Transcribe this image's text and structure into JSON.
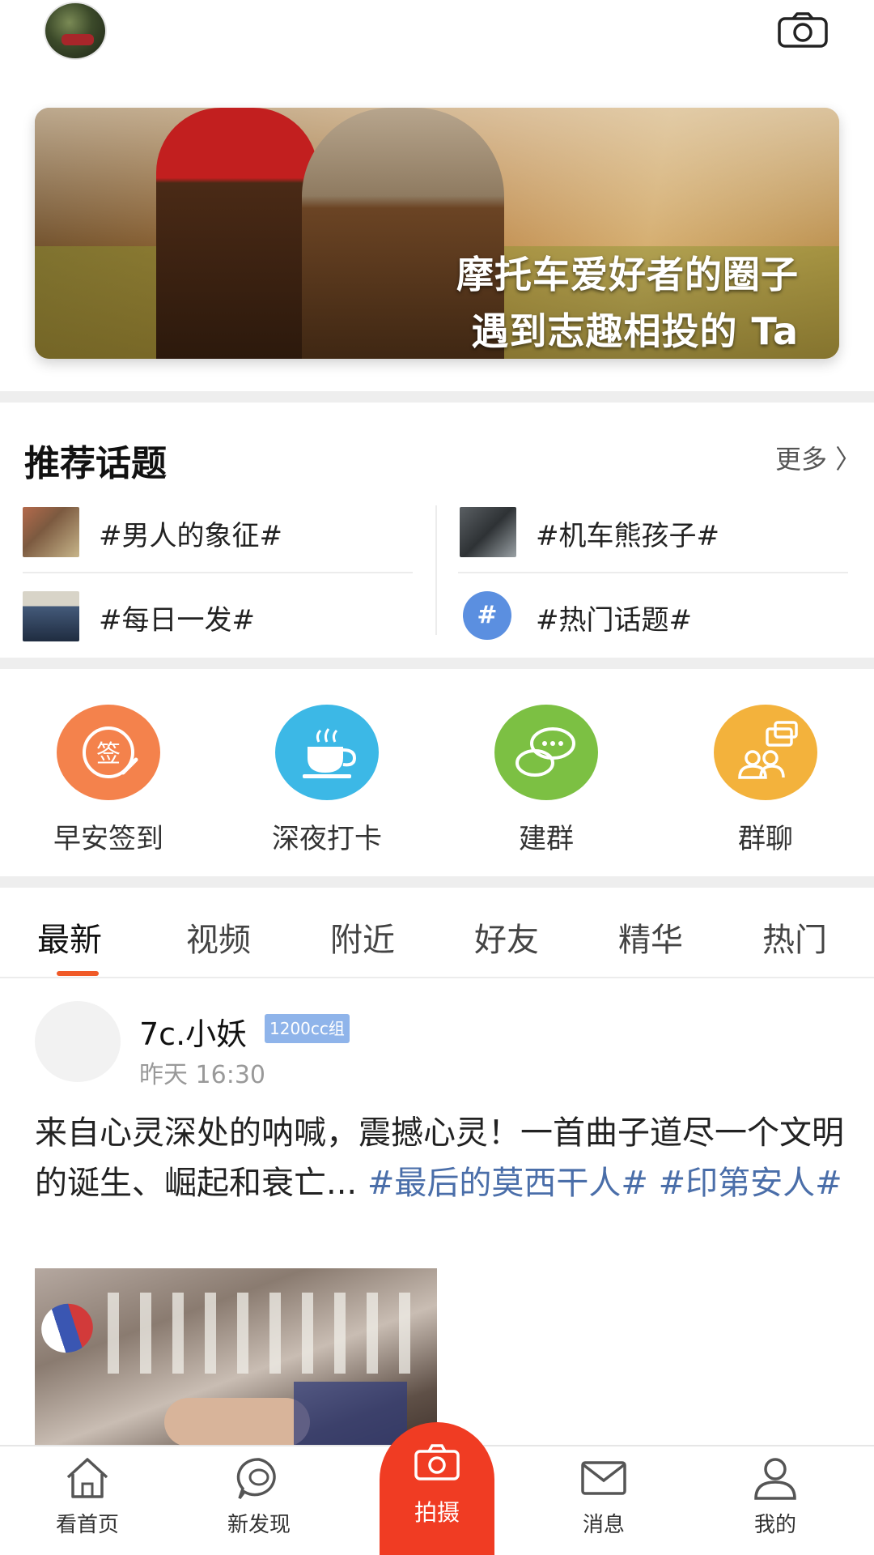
{
  "header": {
    "avatar_icon": "user-avatar",
    "camera_icon": "camera-icon"
  },
  "banner": {
    "line1": "摩托车爱好者的圈子",
    "line2": "遇到志趣相投的 Ta"
  },
  "topics": {
    "title": "推荐话题",
    "more": "更多 〉",
    "items": [
      {
        "label": "#男人的象征#"
      },
      {
        "label": "#机车熊孩子#"
      },
      {
        "label": "#每日一发#"
      },
      {
        "label": "#热门话题#",
        "icon_text": "#"
      }
    ]
  },
  "shortcuts": [
    {
      "label": "早安签到",
      "icon_text": "签",
      "color": "#f4824c"
    },
    {
      "label": "深夜打卡",
      "color": "#3cb8e6"
    },
    {
      "label": "建群",
      "color": "#7cc043"
    },
    {
      "label": "群聊",
      "color": "#f3b23c"
    }
  ],
  "tabs": [
    "最新",
    "视频",
    "附近",
    "好友",
    "精华",
    "热门"
  ],
  "active_tab": "最新",
  "post": {
    "user": "7c.小妖",
    "badge": "1200cc组",
    "time": "昨天 16:30",
    "text": "来自心灵深处的呐喊，震撼心灵！一首曲子道尽一个文明的诞生、崛起和衰亡...",
    "tags": "#最后的莫西干人# #印第安人#"
  },
  "bottom_nav": [
    {
      "label": "看首页",
      "icon": "home-icon"
    },
    {
      "label": "新发现",
      "icon": "discover-icon"
    },
    {
      "label": "拍摄",
      "icon": "camera-icon"
    },
    {
      "label": "消息",
      "icon": "mail-icon"
    },
    {
      "label": "我的",
      "icon": "profile-icon"
    }
  ],
  "colors": {
    "accent": "#f05a28",
    "shoot_button": "#f03c23",
    "tag_blue": "#4a6ea9",
    "badge_blue": "#8fb4ea"
  }
}
